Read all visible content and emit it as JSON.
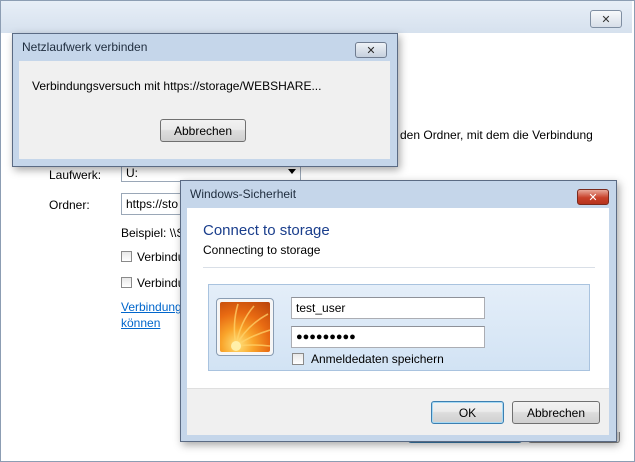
{
  "background_window": {
    "close_glyph": "✕",
    "description_fragment": "den Ordner, mit dem die Verbindung",
    "drive_label": "Laufwerk:",
    "drive_value": "U:",
    "folder_label": "Ordner:",
    "folder_value": "https://sto",
    "example_fragment": "Beispiel: \\\\S",
    "checkbox1_fragment": "Verbindu",
    "checkbox2_fragment": "Verbindu",
    "link_line1": "Verbindung",
    "link_line2": "können"
  },
  "progress_dialog": {
    "title": "Netzlaufwerk verbinden",
    "close_glyph": "✕",
    "message": "Verbindungsversuch mit https://storage/WEBSHARE...",
    "cancel_label": "Abbrechen"
  },
  "security_dialog": {
    "title": "Windows-Sicherheit",
    "close_glyph": "✕",
    "heading": "Connect to storage",
    "subheading": "Connecting to storage",
    "username_value": "test_user",
    "password_value": "●●●●●●●●●",
    "remember_label": "Anmeldedaten speichern",
    "ok_label": "OK",
    "cancel_label": "Abbrechen",
    "heading_color": "#1a3e8c"
  }
}
